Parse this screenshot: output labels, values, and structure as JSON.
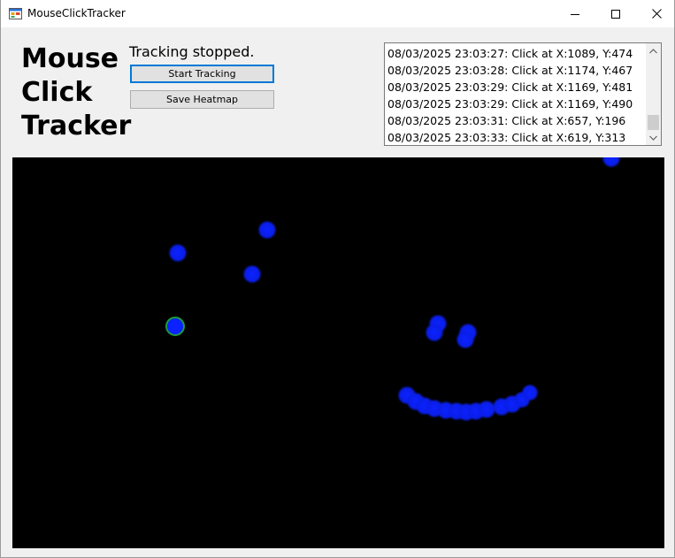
{
  "window": {
    "title": "MouseClickTracker",
    "icon": "app-window-icon",
    "controls": [
      "minimize-icon",
      "maximize-icon",
      "close-icon"
    ]
  },
  "header": {
    "title_lines": [
      "Mouse",
      "Click",
      "Tracker"
    ],
    "status": "Tracking stopped."
  },
  "buttons": {
    "start": "Start Tracking",
    "save": "Save Heatmap"
  },
  "log": {
    "entries": [
      "08/03/2025 23:03:27: Click at X:1089, Y:474",
      "08/03/2025 23:03:28: Click at X:1174, Y:467",
      "08/03/2025 23:03:29: Click at X:1169, Y:481",
      "08/03/2025 23:03:29: Click at X:1169, Y:490",
      "08/03/2025 23:03:31: Click at X:657, Y:196",
      "08/03/2025 23:03:33: Click at X:619, Y:313"
    ],
    "scroll_position": 0.85
  },
  "heatmap": {
    "background": "#000000",
    "point_color": "#0a1fe6",
    "hot_outline_color": "#1f9a3a"
  }
}
